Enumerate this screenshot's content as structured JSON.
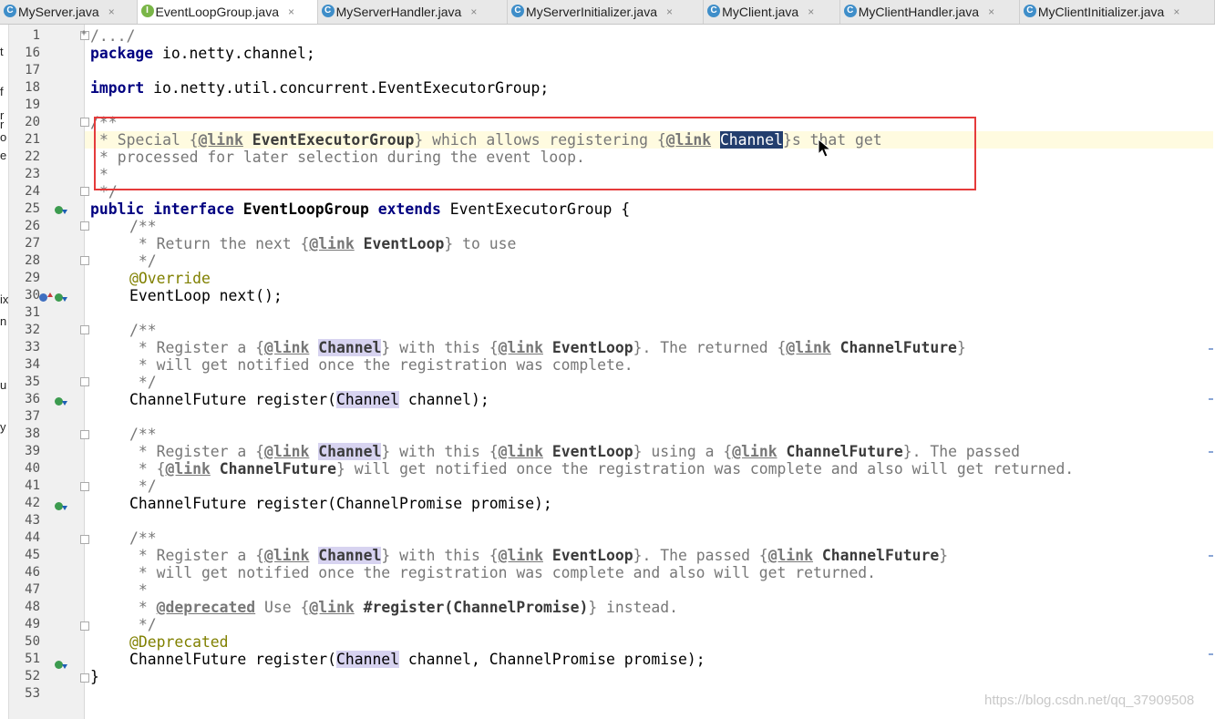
{
  "tabs": [
    {
      "label": "MyServer.java",
      "icon": "c"
    },
    {
      "label": "EventLoopGroup.java",
      "icon": "i",
      "active": true
    },
    {
      "label": "MyServerHandler.java",
      "icon": "c"
    },
    {
      "label": "MyServerInitializer.java",
      "icon": "c"
    },
    {
      "label": "MyClient.java",
      "icon": "c"
    },
    {
      "label": "MyClientHandler.java",
      "icon": "c"
    },
    {
      "label": "MyClientInitializer.java",
      "icon": "c"
    }
  ],
  "tab_close_glyph": "×",
  "tab_icon_letters": {
    "class": "C",
    "interface": "I"
  },
  "left_strip_chars": [
    "t",
    "f",
    "r",
    "r",
    "o",
    "e",
    "ix",
    "n",
    "u",
    "y"
  ],
  "line_numbers": [
    "1",
    "16",
    "17",
    "18",
    "19",
    "20",
    "21",
    "22",
    "23",
    "24",
    "25",
    "26",
    "27",
    "28",
    "29",
    "30",
    "31",
    "32",
    "33",
    "34",
    "35",
    "36",
    "37",
    "38",
    "39",
    "40",
    "41",
    "42",
    "43",
    "44",
    "45",
    "46",
    "47",
    "48",
    "49",
    "50",
    "51",
    "52",
    "53"
  ],
  "code": {
    "l1": "/.../",
    "l16_kw": "package",
    "l16_rest": " io.netty.channel;",
    "l18_kw": "import",
    "l18_rest": " io.netty.util.concurrent.EventExecutorGroup;",
    "l20": "/**",
    "l21_a": "* Special {",
    "l21_tag1": "@link",
    "l21_ref1": "EventExecutorGroup",
    "l21_b": "} which allows registering {",
    "l21_tag2": "@link",
    "l21_sel": "Channel",
    "l21_c": "}s that get",
    "l22": "* processed for later selection during the event loop.",
    "l23": "*",
    "l24": "*/",
    "l25_kw1": "public interface",
    "l25_name": " EventLoopGroup ",
    "l25_kw2": "extends",
    "l25_rest": " EventExecutorGroup {",
    "l26": "/**",
    "l27_a": " * Return the next {",
    "l27_tag": "@link",
    "l27_ref": "EventLoop",
    "l27_b": "} to use",
    "l28": " */",
    "l29": "@Override",
    "l30": "EventLoop next();",
    "l32": "/**",
    "l33_a": " * Register a {",
    "l33_tag1": "@link",
    "l33_ref1": "Channel",
    "l33_b": "} with this {",
    "l33_tag2": "@link",
    "l33_ref2": "EventLoop",
    "l33_c": "}. The returned {",
    "l33_tag3": "@link",
    "l33_ref3": "ChannelFuture",
    "l33_d": "}",
    "l34": " * will get notified once the registration was complete.",
    "l35": " */",
    "l36_a": "ChannelFuture register(",
    "l36_hl": "Channel",
    "l36_b": " channel);",
    "l38": "/**",
    "l39_a": " * Register a {",
    "l39_tag1": "@link",
    "l39_ref1": "Channel",
    "l39_b": "} with this {",
    "l39_tag2": "@link",
    "l39_ref2": "EventLoop",
    "l39_c": "} using a {",
    "l39_tag3": "@link",
    "l39_ref3": "ChannelFuture",
    "l39_d": "}. The passed",
    "l40_a": " * {",
    "l40_tag": "@link",
    "l40_ref": "ChannelFuture",
    "l40_b": "} will get notified once the registration was complete and also will get returned.",
    "l41": " */",
    "l42": "ChannelFuture register(ChannelPromise promise);",
    "l44": "/**",
    "l45_a": " * Register a {",
    "l45_tag1": "@link",
    "l45_ref1": "Channel",
    "l45_b": "} with this {",
    "l45_tag2": "@link",
    "l45_ref2": "EventLoop",
    "l45_c": "}. The passed {",
    "l45_tag3": "@link",
    "l45_ref3": "ChannelFuture",
    "l45_d": "}",
    "l46": " * will get notified once the registration was complete and also will get returned.",
    "l47": " *",
    "l48_a": " * ",
    "l48_tag1": "@deprecated",
    "l48_b": " Use {",
    "l48_tag2": "@link",
    "l48_ref": "#register(ChannelPromise)",
    "l48_c": "} instead.",
    "l49": " */",
    "l50": "@Deprecated",
    "l51_a": "ChannelFuture register(",
    "l51_hl": "Channel",
    "l51_b": " channel, ChannelPromise promise);",
    "l52": "}"
  },
  "watermark": "https://blog.csdn.net/qq_37909508",
  "colors": {
    "keyword": "#000080",
    "comment": "#777777",
    "annotation": "#808000",
    "usage_highlight": "#d7d3f0",
    "selection": "#233e6e",
    "current_line": "#fffbe0",
    "red_box": "#e53b3b"
  }
}
